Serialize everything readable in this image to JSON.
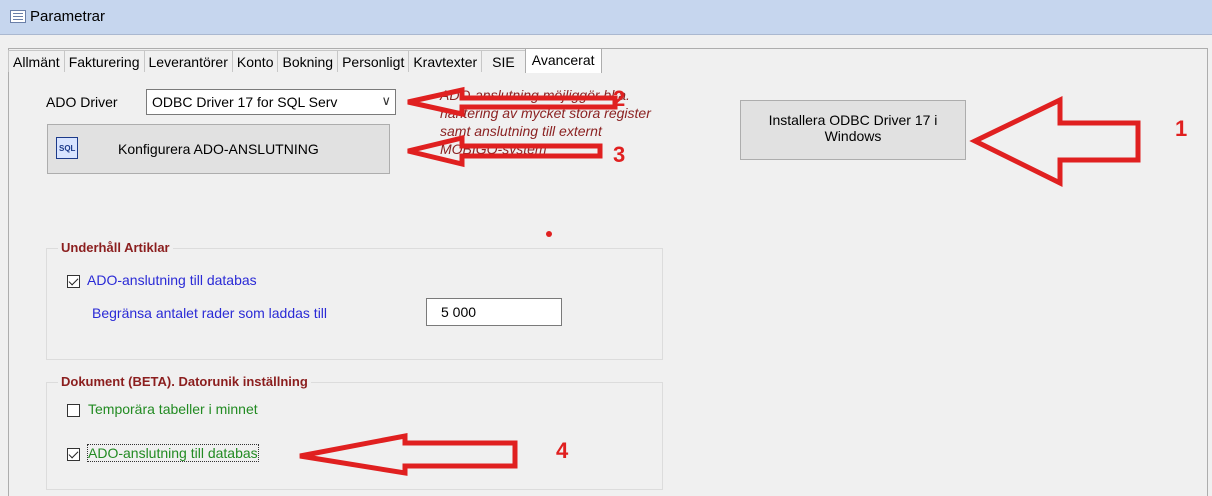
{
  "window": {
    "title": "Parametrar"
  },
  "tabs": [
    {
      "label": "Allmänt"
    },
    {
      "label": "Fakturering"
    },
    {
      "label": "Leverantörer"
    },
    {
      "label": "Konto"
    },
    {
      "label": "Bokning"
    },
    {
      "label": "Personligt"
    },
    {
      "label": "Kravtexter"
    },
    {
      "label": "SIE"
    },
    {
      "label": "Avancerat"
    }
  ],
  "ado": {
    "driver_label": "ADO Driver",
    "driver_value": "ODBC Driver 17 for SQL Serv",
    "configure_button": "Konfigurera ADO-ANSLUTNING",
    "install_button_line1": "Installera ODBC Driver 17 i",
    "install_button_line2": "Windows",
    "hint_lines": [
      "ADO-anslutning möjliggör bl.a.",
      "hantering av mycket stora register",
      "samt anslutning till externt",
      "MOBIGO-system"
    ]
  },
  "group_articles": {
    "title": "Underhåll Artiklar",
    "checkbox_label": "ADO-anslutning till databas",
    "checked": true,
    "limit_label": "Begränsa antalet rader som laddas till",
    "limit_value": "5 000"
  },
  "group_documents": {
    "title": "Dokument (BETA). Datorunik inställning",
    "temp_label": "Temporära tabeller i minnet",
    "temp_checked": false,
    "ado_label": "ADO-anslutning till databas",
    "ado_checked": true
  },
  "annotations": {
    "n1": "1",
    "n2": "2",
    "n3": "3",
    "n4": "4",
    "arrow_color": "#e02020"
  }
}
